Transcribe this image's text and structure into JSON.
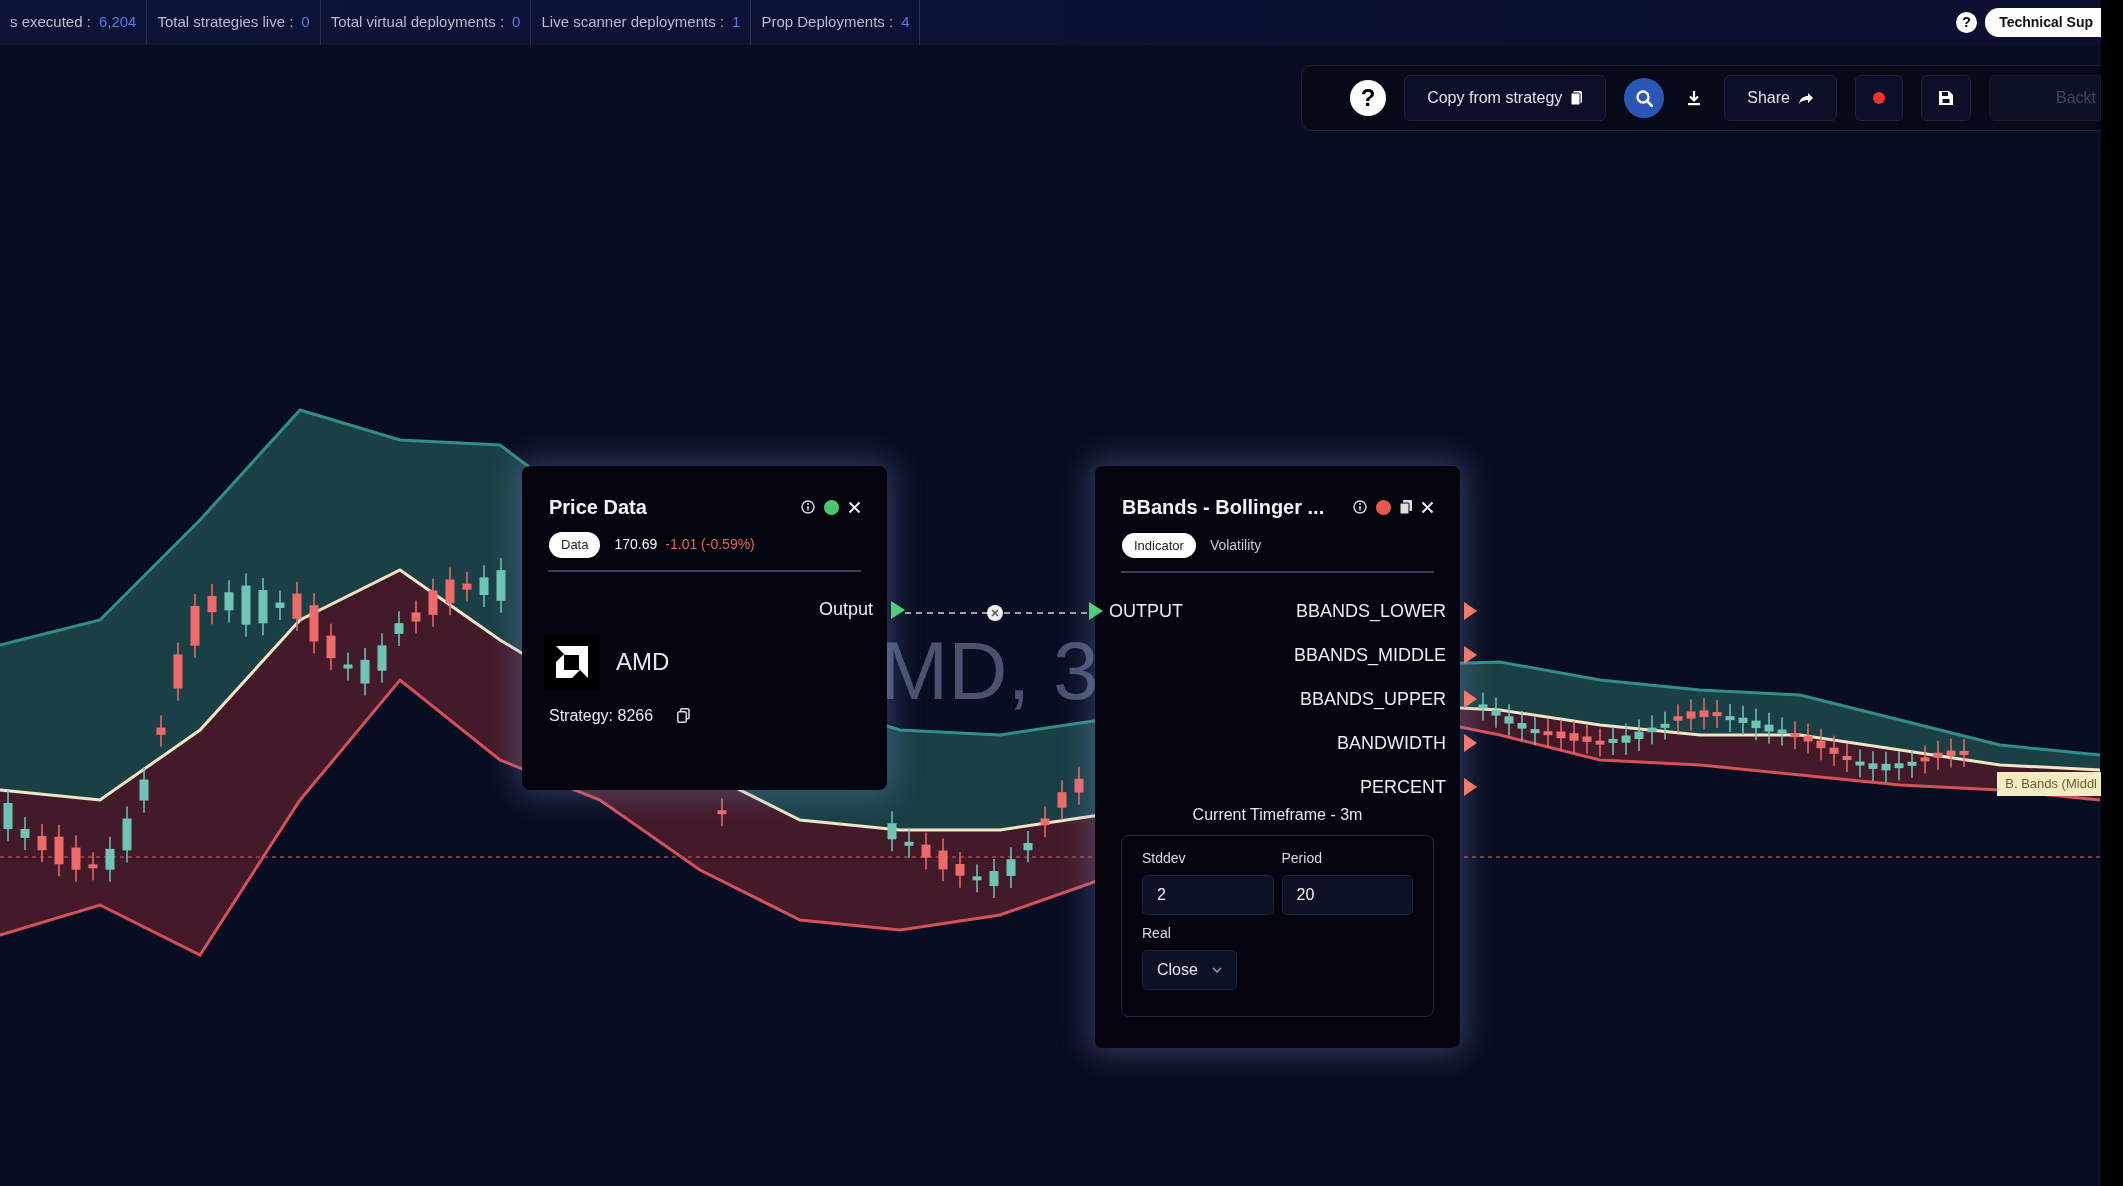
{
  "stats_bar": [
    {
      "label": "s executed :",
      "value": "6,204"
    },
    {
      "label": "Total strategies live :",
      "value": "0"
    },
    {
      "label": "Total virtual deployments :",
      "value": "0"
    },
    {
      "label": "Live scanner deployments :",
      "value": "1"
    },
    {
      "label": "Prop Deployments :",
      "value": "4"
    }
  ],
  "top_right": {
    "help": "?",
    "support": "Technical Sup"
  },
  "toolbar": [
    {
      "kind": "help",
      "label": "?"
    },
    {
      "kind": "copy",
      "label": "Copy from strategy"
    },
    {
      "kind": "search",
      "selected": true
    },
    {
      "kind": "download"
    },
    {
      "kind": "share",
      "label": "Share"
    },
    {
      "kind": "record"
    },
    {
      "kind": "save"
    },
    {
      "kind": "backtest",
      "label": "Backt",
      "disabled": true
    }
  ],
  "chart": {
    "watermark": "MD, 3",
    "legend": "B. Bands (Middl"
  },
  "price_node": {
    "title": "Price Data",
    "active": true,
    "tag": "Data",
    "price": "170.69",
    "change": "-1.01 (-0.59%)",
    "output": "Output",
    "symbol": "AMD",
    "strategy": "Strategy: 8266"
  },
  "indicator_node": {
    "title": "BBands - Bollinger ...",
    "active": false,
    "tags": [
      {
        "label": "Indicator",
        "selected": true
      },
      {
        "label": "Volatility",
        "selected": false
      }
    ],
    "input": "OUTPUT",
    "outputs": [
      "BBANDS_LOWER",
      "BBANDS_MIDDLE",
      "BBANDS_UPPER",
      "BANDWIDTH",
      "PERCENT"
    ],
    "timeframe": "Current Timeframe - 3m",
    "params": [
      {
        "kind": "input",
        "label": "Stddev",
        "value": "2"
      },
      {
        "kind": "input",
        "label": "Period",
        "value": "20"
      },
      {
        "kind": "select",
        "label": "Real",
        "value": "Close"
      }
    ]
  }
}
